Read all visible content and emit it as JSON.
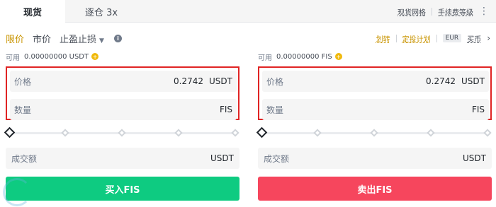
{
  "tabs": {
    "spot": "现货",
    "margin": "逐仓 3x"
  },
  "top_links": {
    "spot_grid": "现货网格",
    "fee_level": "手续费等级"
  },
  "order_types": {
    "limit": "限价",
    "market": "市价",
    "tp_sl": "止盈止损"
  },
  "tools": {
    "transfer": "划转",
    "auto_invest": "定投计划",
    "currency": "EUR",
    "buy_link": "买币"
  },
  "buy": {
    "available_label": "可用",
    "available_value": "0.00000000 USDT",
    "price_placeholder": "价格",
    "price_value": "0.2742",
    "price_unit": "USDT",
    "qty_placeholder": "数量",
    "qty_unit": "FIS",
    "total_placeholder": "成交额",
    "total_unit": "USDT",
    "button": "买入FIS"
  },
  "sell": {
    "available_label": "可用",
    "available_value": "0.00000000 FIS",
    "price_placeholder": "价格",
    "price_value": "0.2742",
    "price_unit": "USDT",
    "qty_placeholder": "数量",
    "qty_unit": "FIS",
    "total_placeholder": "成交额",
    "total_unit": "USDT",
    "button": "卖出FIS"
  },
  "colors": {
    "buy": "#0ecb81",
    "sell": "#f6465d",
    "accent": "#c99400",
    "highlight_border": "#e02424"
  }
}
